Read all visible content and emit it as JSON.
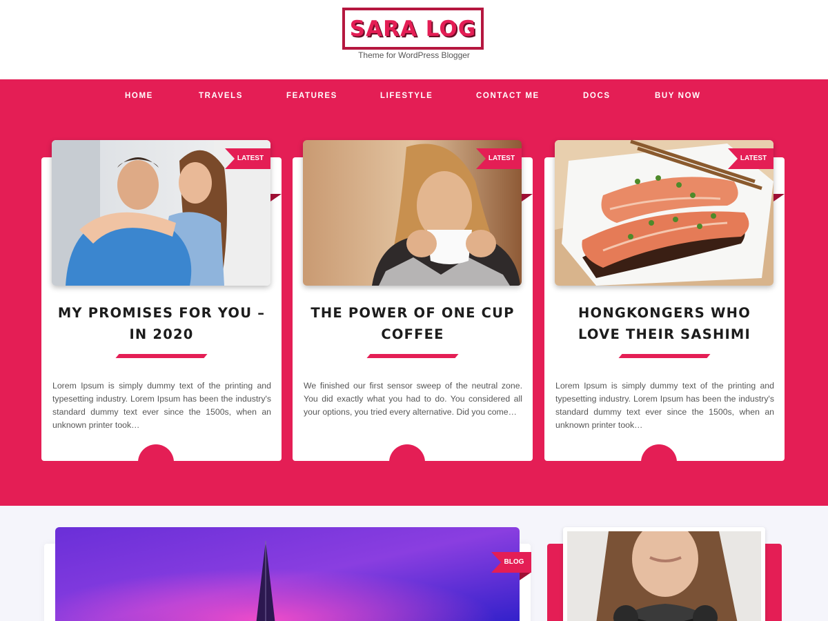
{
  "site": {
    "logo": "SARA LOG",
    "tagline": "Theme for WordPress Blogger"
  },
  "nav": {
    "items": [
      {
        "label": "HOME"
      },
      {
        "label": "TRAVELS"
      },
      {
        "label": "FEATURES"
      },
      {
        "label": "LIFESTYLE"
      },
      {
        "label": "CONTACT ME"
      },
      {
        "label": "DOCS"
      },
      {
        "label": "BUY NOW"
      }
    ]
  },
  "featured": [
    {
      "badge": "LATEST",
      "title": "MY PROMISES FOR YOU – IN 2020",
      "excerpt": "Lorem Ipsum is simply dummy text of the printing and typesetting industry. Lorem Ipsum has been the industry's standard dummy text ever since the 1500s, when an unknown printer took…"
    },
    {
      "badge": "LATEST",
      "title": "THE POWER OF ONE CUP COFFEE",
      "excerpt": "We finished our first sensor sweep of the neutral zone. You did exactly what you had to do. You considered all your options, you tried every alternative. Did you come…"
    },
    {
      "badge": "LATEST",
      "title": "HONGKONGERS WHO LOVE THEIR SASHIMI",
      "excerpt": "Lorem Ipsum is simply dummy text of the printing and typesetting industry. Lorem Ipsum has been the industry's standard dummy text ever since the 1500s, when an unknown printer took…"
    }
  ],
  "blog": {
    "badge": "BLOG"
  },
  "colors": {
    "accent": "#e41e55",
    "accent_dark": "#9e0f34",
    "background_light": "#f5f5fb"
  },
  "icons": {
    "ribbon": "ribbon-badge"
  }
}
